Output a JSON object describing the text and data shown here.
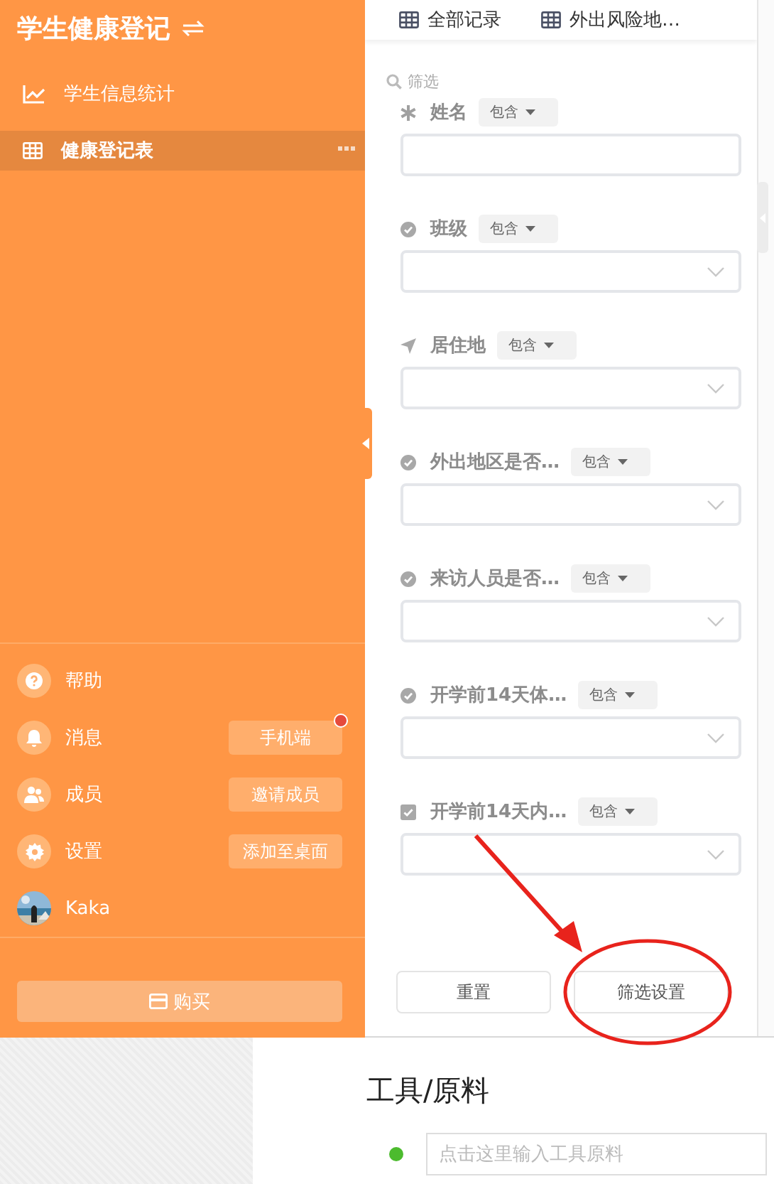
{
  "sidebar": {
    "title": "学生健康登记",
    "items": [
      {
        "label": "学生信息统计",
        "kind": "chart",
        "selected": false
      },
      {
        "label": "健康登记表",
        "kind": "table",
        "selected": true
      }
    ],
    "footer_items": [
      {
        "label": "帮助",
        "kind": "help"
      },
      {
        "label": "消息",
        "kind": "bell",
        "button": "手机端",
        "notification": true
      },
      {
        "label": "成员",
        "kind": "people",
        "button": "邀请成员"
      },
      {
        "label": "设置",
        "kind": "gear",
        "button": "添加至桌面"
      }
    ],
    "user": {
      "name": "Kaka"
    },
    "buy_button": "购买"
  },
  "tabs": [
    {
      "label": "全部记录"
    },
    {
      "label": "外出风险地…"
    }
  ],
  "filter": {
    "title": "筛选",
    "fields": [
      {
        "label": "姓名",
        "kind": "text",
        "operator": "包含"
      },
      {
        "label": "班级",
        "kind": "select",
        "operator": "包含"
      },
      {
        "label": "居住地",
        "kind": "location",
        "operator": "包含"
      },
      {
        "label": "外出地区是否…",
        "kind": "select",
        "operator": "包含"
      },
      {
        "label": "来访人员是否…",
        "kind": "select",
        "operator": "包含"
      },
      {
        "label": "开学前14天体…",
        "kind": "select",
        "operator": "包含"
      },
      {
        "label": "开学前14天内…",
        "kind": "checkbox",
        "operator": "包含"
      }
    ],
    "buttons": [
      "重置",
      "筛选设置"
    ]
  },
  "article": {
    "heading": "工具/原料",
    "items": [
      {
        "placeholder": "点击这里输入工具原料"
      }
    ]
  }
}
